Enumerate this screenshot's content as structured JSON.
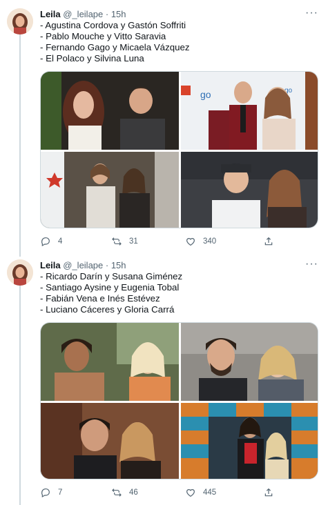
{
  "tweets": [
    {
      "author_name": "Leila",
      "handle": "@_leilape",
      "time": "· 15h",
      "more_icon": "more-dots-icon",
      "lines": [
        "- Agustina Cordova y Gastón Soffriti",
        "- Pablo Mouche y Vitto Saravia",
        "- Fernando Gago y Micaela Vázquez",
        "- El Polaco y Silvina Luna"
      ],
      "stats": {
        "replies": "4",
        "retweets": "31",
        "likes": "340"
      }
    },
    {
      "author_name": "Leila",
      "handle": "@_leilape",
      "time": "· 15h",
      "more_icon": "more-dots-icon",
      "lines": [
        "- Ricardo Darín y Susana Giménez",
        "- Santiago Aysine y Eugenia Tobal",
        "- Fabián Vena e Inés Estévez",
        "- Luciano Cáceres y Gloria Carrá"
      ],
      "stats": {
        "replies": "7",
        "retweets": "46",
        "likes": "445"
      }
    }
  ],
  "colors": {
    "text": "#0f1419",
    "secondary": "#536471",
    "thread_line": "#cfd9de",
    "border": "#cfd9de"
  },
  "icons": [
    "reply-icon",
    "retweet-icon",
    "like-icon",
    "share-icon",
    "more-dots-icon"
  ]
}
